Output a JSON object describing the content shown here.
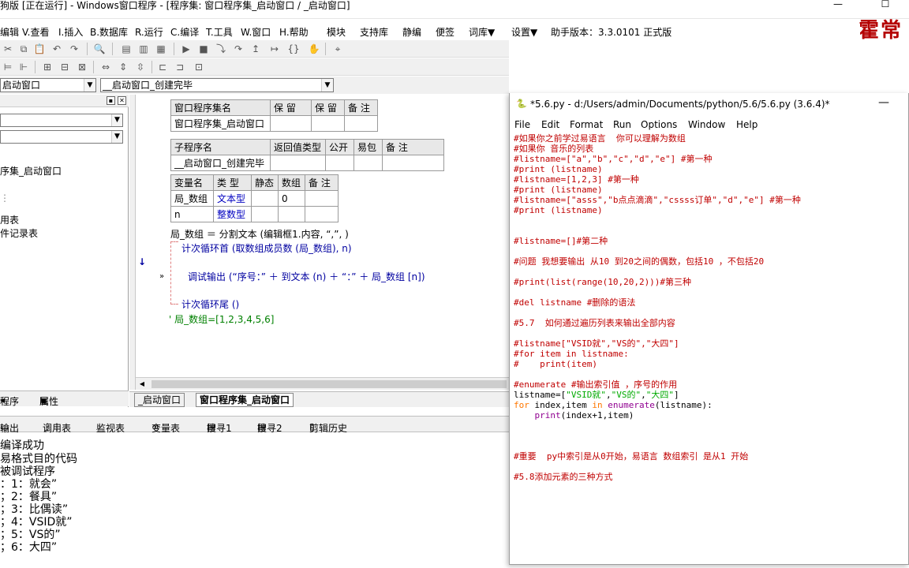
{
  "main_title": "狗版 [正在运行] - Windows窗口程序 - [程序集: 窗口程序集_启动窗口 / _启动窗口]",
  "brand_text": "霍常",
  "menu": [
    "编辑",
    "V.查看",
    "I.插入",
    "B.数据库",
    "R.运行",
    "C.编译",
    "T.工具",
    "W.窗口",
    "H.帮助",
    "模块",
    "支持库",
    "静编",
    "便签",
    "词库▼",
    "设置▼",
    "助手版本：3.3.0101 正式版"
  ],
  "combos": {
    "left": "启动窗口",
    "right": "__启动窗口_创建完毕"
  },
  "left_panel": {
    "tree": [
      "序集_启动窗口",
      "用表",
      "件记录表"
    ],
    "tabs": [
      "程序",
      "属性"
    ]
  },
  "assembly_table": {
    "headers": [
      "窗口程序集名",
      "保 留",
      "保 留",
      "备 注"
    ],
    "row": [
      "窗口程序集_启动窗口",
      "",
      "",
      ""
    ]
  },
  "sub_table": {
    "headers": [
      "子程序名",
      "返回值类型",
      "公开",
      "易包",
      "备 注"
    ],
    "row": [
      "__启动窗口_创建完毕",
      "",
      "",
      "",
      ""
    ]
  },
  "var_table": {
    "headers": [
      "变量名",
      "类 型",
      "静态",
      "数组",
      "备 注"
    ],
    "rows": [
      [
        "局_数组",
        "文本型",
        "",
        "0",
        ""
      ],
      [
        "n",
        "整数型",
        "",
        "",
        ""
      ]
    ]
  },
  "code_lines": {
    "l1": "局_数组 ＝ 分割文本 (编辑框1.内容, “,”, )",
    "l2": "计次循环首 (取数组成员数 (局_数组), n)",
    "l3": "调试输出 (“序号：” ＋ 到文本 (n) ＋ “：” ＋ 局_数组 [n])",
    "l4": "计次循环尾 ()",
    "l5": "' 局_数组=[1,2,3,4,5,6]"
  },
  "code_tabs": [
    "_启动窗口",
    "窗口程序集_启动窗口"
  ],
  "output_tabs": [
    "输出",
    "调用表",
    "监视表",
    "变量表",
    "搜寻1",
    "搜寻2",
    "剪辑历史"
  ],
  "output_lines": [
    "编译成功",
    "易格式目的代码",
    "被调试程序",
    "：1：就会”",
    "；2：餐具”",
    "；3：比偶读”",
    "；4：VSID就”",
    "；5：VS的”",
    "；6：大四”"
  ],
  "python": {
    "title": "*5.6.py - d:/Users/admin/Documents/python/5.6/5.6.py (3.6.4)*",
    "menu": [
      "File",
      "Edit",
      "Format",
      "Run",
      "Options",
      "Window",
      "Help"
    ],
    "code": [
      "#如果你之前学过易语言  你可以理解为数组",
      "#如果你 音乐的列表",
      "#listname=[\"a\",\"b\",\"c\",\"d\",\"e\"] #第一种",
      "#print (listname)",
      "#listname=[1,2,3] #第一种",
      "#print (listname)",
      "#listname=[\"asss\",\"b点点滴滴\",\"cssss订单\",\"d\",\"e\"] #第一种",
      "#print (listname)",
      "",
      "",
      "#listname=[]#第二种",
      "",
      "#问题 我想要输出 从10 到20之间的偶数，包括10 ，不包括20",
      "",
      "#print(list(range(10,20,2)))#第三种",
      "",
      "#del listname #删除的语法",
      "",
      "#5.7  如何通过遍历列表来输出全部内容",
      "",
      "#listname[\"VSID就\",\"VS的\",\"大四\"]",
      "#for item in listname:",
      "#    print(item)",
      "",
      "#enumerate #输出索引值 ，序号的作用",
      "listname=[\"VSID就\",\"VS的\",\"大四\"]",
      "for index,item in enumerate(listname):",
      "    print(index+1,item)",
      "",
      "",
      "",
      "#重要  py中索引是从0开始，易语言 数组索引 是从1 开始",
      "",
      "#5.8添加元素的三种方式"
    ]
  }
}
